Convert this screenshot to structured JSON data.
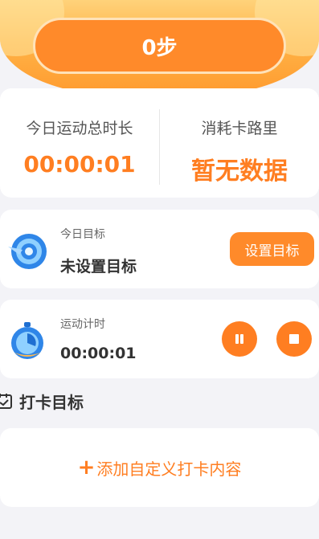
{
  "header": {
    "steps_label": "0步"
  },
  "stats": {
    "duration_label": "今日运动总时长",
    "duration_value": "00:00:01",
    "calories_label": "消耗卡路里",
    "calories_value": "暂无数据"
  },
  "goal": {
    "subtitle": "今日目标",
    "status": "未设置目标",
    "button_label": "设置目标",
    "icon": "target-icon"
  },
  "timer": {
    "subtitle": "运动计时",
    "value": "00:00:01",
    "icon": "stopwatch-icon",
    "pause_icon": "pause-icon",
    "stop_icon": "stop-icon"
  },
  "checkin": {
    "section_title": "打卡目标",
    "add_label": "添加自定义打卡内容",
    "add_symbol": "+"
  },
  "colors": {
    "accent": "#ff7e21",
    "background": "#f3f3f7"
  }
}
